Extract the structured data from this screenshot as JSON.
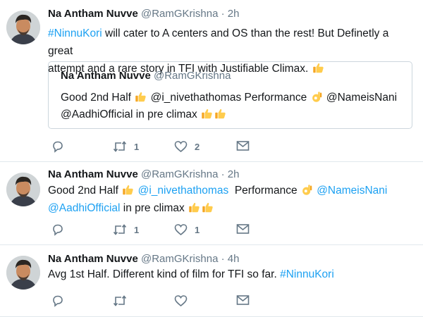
{
  "tweets": [
    {
      "name": "Na Antham Nuvve",
      "handle": "@RamGKrishna",
      "dot": "·",
      "time": "2h",
      "text_parts": {
        "hashtag": "#NinnuKori",
        "line1_rest": " will  cater to A centers and OS than the rest! But Definetly a great",
        "line2": "attempt and a rare story in TFI with Justifiable Climax."
      },
      "quote": {
        "name": "Na Antham Nuvve",
        "handle": "@RamGKrishna",
        "line1_a": "Good 2nd Half",
        "line1_b": "@i_nivethathomas   Performance",
        "line1_c": "@NameisNani",
        "line2": "@AadhiOfficial in pre climax"
      },
      "retweets": "1",
      "likes": "2"
    },
    {
      "name": "Na Antham Nuvve",
      "handle": "@RamGKrishna",
      "dot": "·",
      "time": "2h",
      "line1_a": "Good 2nd Half",
      "mention1": "@i_nivethathomas",
      "line1_b": "Performance",
      "mention2": "@NameisNani",
      "mention3": "@AadhiOfficial",
      "line2_b": " in pre climax",
      "retweets": "1",
      "likes": "1"
    },
    {
      "name": "Na Antham Nuvve",
      "handle": "@RamGKrishna",
      "dot": "·",
      "time": "4h",
      "text": "Avg 1st Half. Different kind of film for TFI so far. ",
      "hashtag": "#NinnuKori"
    }
  ],
  "colors": {
    "link": "#1da1f2",
    "muted": "#657786",
    "border": "#e1e8ed"
  },
  "icons": [
    "reply-icon",
    "retweet-icon",
    "like-icon",
    "dm-icon",
    "thumbs-up-emoji",
    "ok-hand-emoji"
  ]
}
